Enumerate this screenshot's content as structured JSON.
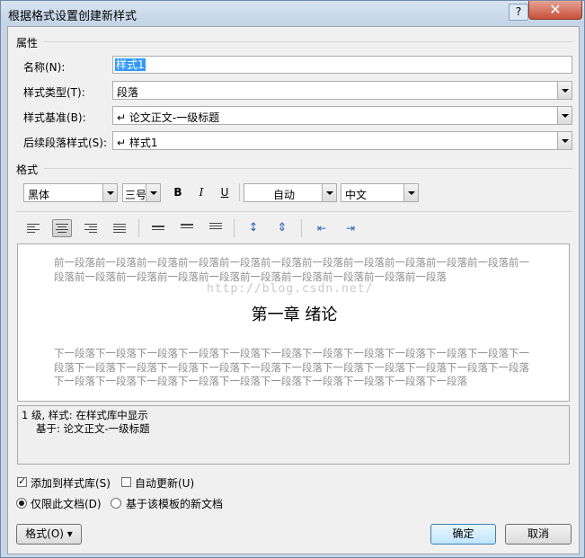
{
  "window": {
    "title": "根据格式设置创建新样式",
    "help_label": "?",
    "close_label": "✕"
  },
  "properties": {
    "section_label": "属性",
    "name_label": "名称(N):",
    "name_value": "样式1",
    "type_label": "样式类型(T):",
    "type_value": "段落",
    "based_on_label": "样式基准(B):",
    "based_on_value": "↵ 论文正文-一级标题",
    "next_label": "后续段落样式(S):",
    "next_value": "↵ 样式1"
  },
  "format": {
    "section_label": "格式",
    "font": "黑体",
    "size": "三号",
    "bold": "B",
    "italic": "I",
    "underline": "U",
    "color": "自动",
    "script": "中文"
  },
  "preview": {
    "prev_paragraph": "前一段落前一段落前一段落前一段落前一段落前一段落前一段落前一段落前一段落前一段落前一段落前一段落前一段落前一段落前一段落前一段落前一段落前一段落前一段落前一段落前一段落",
    "watermark": "http://blog.csdn.net/",
    "heading": "第一章  绪论",
    "next_paragraph": "下一段落下一段落下一段落下一段落下一段落下一段落下一段落下一段落下一段落下一段落下一段落下一段落下一段落下一段落下一段落下一段落下一段落下一段落下一段落下一段落下一段落下一段落下一段落下一段落下一段落下一段落下一段落下一段落下一段落下一段落下一段落下一段落下一段落"
  },
  "description": {
    "line1": "1 级, 样式: 在样式库中显示",
    "line2": "基于: 论文正文-一级标题"
  },
  "options": {
    "add_to_gallery": "添加到样式库(S)",
    "add_to_gallery_checked": true,
    "auto_update": "自动更新(U)",
    "auto_update_checked": false,
    "only_this_doc": "仅限此文档(D)",
    "new_docs_template": "基于该模板的新文档"
  },
  "buttons": {
    "format_menu": "格式(O) ▾",
    "ok": "确定",
    "cancel": "取消"
  }
}
